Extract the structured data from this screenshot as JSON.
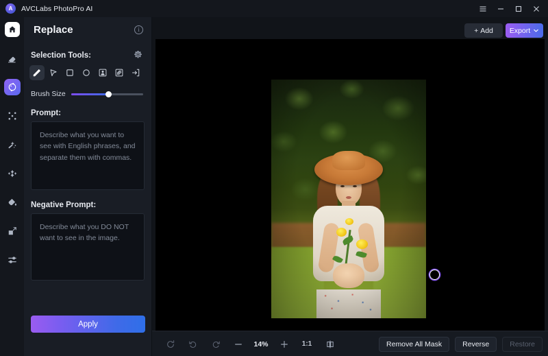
{
  "app": {
    "title": "AVCLabs PhotoPro AI",
    "logo_letter": "A"
  },
  "window_controls": {
    "menu": "menu-icon",
    "minimize": "minimize-icon",
    "maximize": "maximize-icon",
    "close": "close-icon"
  },
  "rail": {
    "home": "home-icon",
    "items": [
      {
        "name": "eraser-tool",
        "icon": "eraser-icon",
        "active": false
      },
      {
        "name": "replace-tool",
        "icon": "replace-icon",
        "active": true
      },
      {
        "name": "expand-tool",
        "icon": "expand-icon",
        "active": false
      },
      {
        "name": "enhance-tool",
        "icon": "magic-wand-icon",
        "active": false
      },
      {
        "name": "retouch-tool",
        "icon": "retouch-icon",
        "active": false
      },
      {
        "name": "colorize-tool",
        "icon": "paint-drop-icon",
        "active": false
      },
      {
        "name": "upscale-tool",
        "icon": "upscale-icon",
        "active": false
      },
      {
        "name": "adjust-tool",
        "icon": "sliders-icon",
        "active": false
      }
    ]
  },
  "panel": {
    "title": "Replace",
    "info": "i",
    "selection_tools_label": "Selection Tools:",
    "settings_icon": "gear-icon",
    "tools": [
      {
        "name": "brush-tool",
        "icon": "brush-icon",
        "active": true
      },
      {
        "name": "lasso-tool",
        "icon": "cursor-icon",
        "active": false
      },
      {
        "name": "rectangle-tool",
        "icon": "rectangle-icon",
        "active": false
      },
      {
        "name": "ellipse-tool",
        "icon": "circle-icon",
        "active": false
      },
      {
        "name": "subject-select-tool",
        "icon": "person-frame-icon",
        "active": false
      },
      {
        "name": "background-select-tool",
        "icon": "hatched-frame-icon",
        "active": false
      },
      {
        "name": "import-mask-tool",
        "icon": "import-arrow-icon",
        "active": false
      }
    ],
    "brush_size_label": "Brush Size",
    "brush_size_percent": 52,
    "prompt_label": "Prompt:",
    "prompt_value": "",
    "prompt_placeholder": "Describe what you want to see with English phrases, and separate them with commas.",
    "negative_prompt_label": "Negative Prompt:",
    "negative_prompt_value": "",
    "negative_prompt_placeholder": "Describe what you DO NOT want to see in the image.",
    "apply_label": "Apply"
  },
  "workspace": {
    "add_label": "Add",
    "add_icon": "plus-icon",
    "export_label": "Export",
    "export_caret": "chevron-down-icon",
    "canvas": {
      "brush_cursor": "brush-cursor-circle",
      "image_alt": "woman-in-straw-hat-holding-yellow-flowers"
    }
  },
  "bottom_bar": {
    "reset_icon": "reset-icon",
    "undo_icon": "undo-icon",
    "redo_icon": "redo-icon",
    "zoom_out_icon": "minus-icon",
    "zoom_level": "14%",
    "zoom_in_icon": "plus-icon",
    "fit_label": "1:1",
    "compare_icon": "compare-split-icon",
    "remove_all_mask_label": "Remove All Mask",
    "reverse_label": "Reverse",
    "restore_label": "Restore"
  },
  "colors": {
    "accent_purple": "#9b5cf1",
    "accent_blue": "#4a6bea",
    "panel_bg": "#191d25",
    "rail_bg": "#14171d",
    "workspace_bg": "#111419",
    "canvas_bg": "#000000"
  }
}
